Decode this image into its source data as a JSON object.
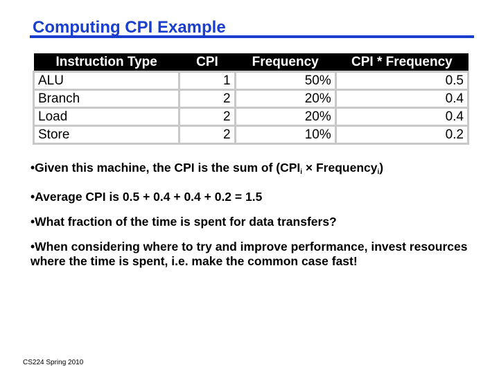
{
  "slide": {
    "title": "Computing CPI Example",
    "title_color": "#1a3fcf",
    "footer": "CS224 Spring 2010"
  },
  "table": {
    "headers": [
      "Instruction Type",
      "CPI",
      "Frequency",
      "CPI * Frequency"
    ],
    "rows": [
      [
        "ALU",
        "1",
        "50%",
        "0.5"
      ],
      [
        "Branch",
        "2",
        "20%",
        "0.4"
      ],
      [
        "Load",
        "2",
        "20%",
        "0.4"
      ],
      [
        "Store",
        "2",
        "10%",
        "0.2"
      ]
    ]
  },
  "bullets": {
    "b1_pre": "•Given this machine, the CPI is the sum of (CPI",
    "b1_sub1": "i",
    "b1_mid": " × Frequency",
    "b1_sub2": "i",
    "b1_post": ")",
    "b2": "•Average CPI is 0.5 + 0.4 + 0.4 + 0.2 = 1.5",
    "b3": "•What fraction of the time is spent for data transfers?",
    "b4": "•When considering where to try and improve performance, invest resources where the time is spent, i.e. make the common case fast!"
  }
}
